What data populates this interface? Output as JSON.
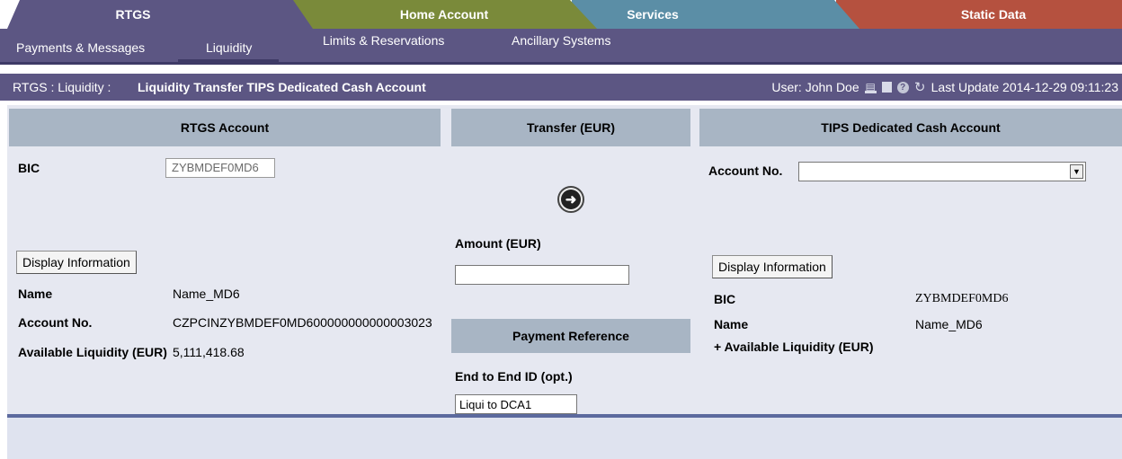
{
  "tabs": [
    {
      "label": "RTGS",
      "color": "#5c5683"
    },
    {
      "label": "Home Account",
      "color": "#7a8a3a"
    },
    {
      "label": "Services",
      "color": "#5b8ea6"
    },
    {
      "label": "Static Data",
      "color": "#b5513f"
    }
  ],
  "submenu": {
    "items": [
      "Payments & Messages",
      "Liquidity",
      "Limits & Reservations",
      "Ancillary Systems"
    ],
    "active": "Liquidity"
  },
  "breadcrumb": {
    "section": "RTGS : Liquidity :",
    "title": "Liquidity Transfer TIPS Dedicated Cash Account",
    "user": "User: John Doe",
    "last_update": "Last Update 2014-12-29 09:11:23"
  },
  "rtgs_account": {
    "header": "RTGS Account",
    "bic_label": "BIC",
    "bic_value": "ZYBMDEF0MD6",
    "display_button": "Display Information",
    "name_label": "Name",
    "name_value": "Name_MD6",
    "account_label": "Account No.",
    "account_value": "CZPCINZYBMDEF0MD600000000000003023",
    "liquidity_label": "Available Liquidity (EUR)",
    "liquidity_value": "5,111,418.68"
  },
  "transfer": {
    "header": "Transfer (EUR)",
    "amount_label": "Amount (EUR)",
    "amount_value": "",
    "payment_reference_header": "Payment Reference",
    "e2e_label": "End to End ID (opt.)",
    "e2e_value": "Liqui to DCA1"
  },
  "tips_account": {
    "header": "TIPS Dedicated Cash Account",
    "account_label": "Account No.",
    "account_value": "",
    "display_button": "Display Information",
    "bic_label": "BIC",
    "bic_value": "ZYBMDEF0MD6",
    "name_label": "Name",
    "name_value": "Name_MD6",
    "liquidity_label": "+ Available Liquidity (EUR)"
  }
}
